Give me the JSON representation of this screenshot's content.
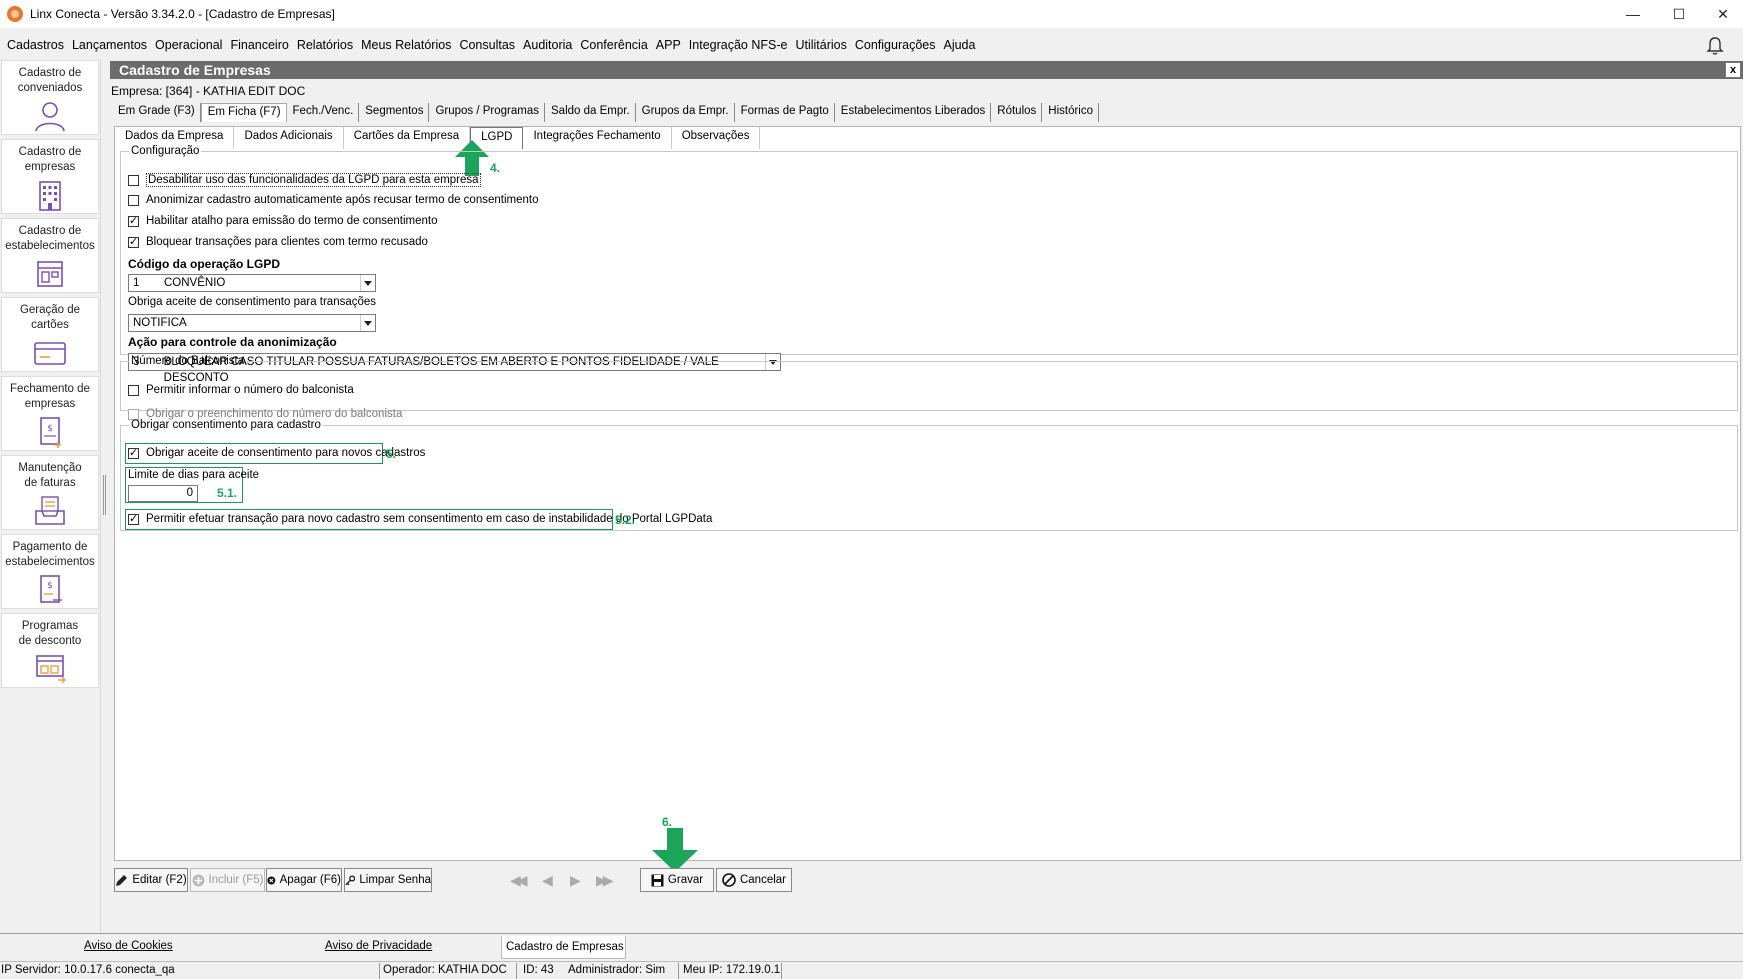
{
  "window": {
    "title": "Linx Conecta - Versão 3.34.2.0 - [Cadastro de Empresas]",
    "minimize": "—",
    "maximize": "☐",
    "close": "✕"
  },
  "menu": [
    "Cadastros",
    "Lançamentos",
    "Operacional",
    "Financeiro",
    "Relatórios",
    "Meus Relatórios",
    "Consultas",
    "Auditoria",
    "Conferência",
    "APP",
    "Integração NFS-e",
    "Utilitários",
    "Configurações",
    "Ajuda"
  ],
  "sidebar": [
    {
      "line1": "Cadastro de",
      "line2": "conveniados",
      "icon": "user-icon"
    },
    {
      "line1": "Cadastro de",
      "line2": "empresas",
      "icon": "building-icon"
    },
    {
      "line1": "Cadastro de",
      "line2": "estabelecimentos",
      "icon": "store-icon"
    },
    {
      "line1": "Geração de",
      "line2": "cartões",
      "icon": "card-icon"
    },
    {
      "line1": "Fechamento de",
      "line2": "empresas",
      "icon": "invoice-icon"
    },
    {
      "line1": "Manutenção",
      "line2": "de faturas",
      "icon": "tray-icon"
    },
    {
      "line1": "Pagamento de",
      "line2": "estabelecimentos",
      "icon": "payment-icon"
    },
    {
      "line1": "Programas",
      "line2": "de desconto",
      "icon": "discount-icon"
    }
  ],
  "panel": {
    "title": "Cadastro de Empresas",
    "close": "x",
    "empresa": "Empresa: [364] - KATHIA EDIT DOC"
  },
  "tabs_main": [
    "Em Grade (F3)",
    "Em Ficha (F7)",
    "Fech./Venc.",
    "Segmentos",
    "Grupos / Programas",
    "Saldo da Empr.",
    "Grupos da Empr.",
    "Formas de Pagto",
    "Estabelecimentos Liberados",
    "Rótulos",
    "Histórico"
  ],
  "tabs_sub": [
    "Dados da Empresa",
    "Dados Adicionais",
    "Cartões da Empresa",
    "LGPD",
    "Integrações Fechamento",
    "Observações"
  ],
  "config": {
    "legend": "Configuração",
    "checks": [
      {
        "label": "Desabilitar uso das funcionalidades da LGPD para esta empresa",
        "checked": false
      },
      {
        "label": "Anonimizar cadastro automaticamente após recusar termo de consentimento",
        "checked": false
      },
      {
        "label": "Habilitar atalho para emissão do termo de consentimento",
        "checked": true
      },
      {
        "label": "Bloquear transações para clientes com termo recusado",
        "checked": true
      }
    ],
    "codigo_label": "Código da operação LGPD",
    "codigo_value_code": "1",
    "codigo_value_text": "CONVÊNIO",
    "obriga_label": "Obriga aceite de consentimento para transações",
    "obriga_value": "NOTIFICA",
    "acao_label": "Ação para controle da anonimização",
    "acao_value_code": "3",
    "acao_value_text": "BLOQUEAR CASO TITULAR POSSUA FATURAS/BOLETOS EM ABERTO E PONTOS FIDELIDADE / VALE DESCONTO"
  },
  "balconista": {
    "legend": "Número do Balconista",
    "check1": "Permitir informar o número do balconista",
    "check2": "Obrigar o preenchimento do número do balconista"
  },
  "consentimento": {
    "legend": "Obrigar consentimento para cadastro",
    "check1": "Obrigar aceite de consentimento para novos cadastros",
    "limite_label": "Limite de dias para aceite",
    "limite_value": "0",
    "check2": "Permitir efetuar transação para novo cadastro sem consentimento em caso de instabilidade do Portal LGPData"
  },
  "steps": {
    "s4": "4.",
    "s5": "5.",
    "s51": "5.1.",
    "s52": "5.2.",
    "s6": "6."
  },
  "toolbar": {
    "editar": "Editar (F2)",
    "incluir": "Incluir (F5)",
    "apagar": "Apagar (F6)",
    "limpar": "Limpar Senha",
    "gravar": "Gravar",
    "cancelar": "Cancelar"
  },
  "footer": {
    "cookies": "Aviso de Cookies",
    "privacidade": "Aviso de Privacidade",
    "tab": "Cadastro de Empresas"
  },
  "status": {
    "servidor": "IP Servidor: 10.0.17.6 conecta_qa",
    "operador": "Operador: KATHIA DOC",
    "id": "ID: 43",
    "admin": "Administrador: Sim",
    "meuip": "Meu IP: 172.19.0.1"
  },
  "colors": {
    "accent_green": "#1aa55a",
    "header_gray": "#6b6b6b",
    "icon_purple": "#7a4fb5"
  }
}
